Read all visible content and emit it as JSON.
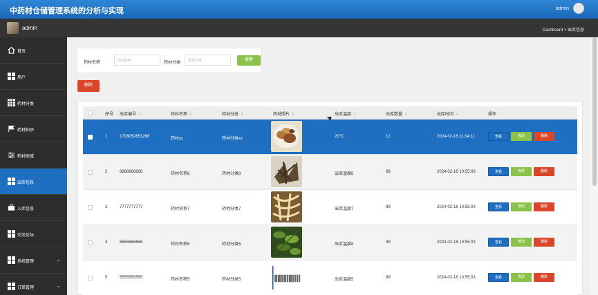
{
  "header": {
    "title": "中药材仓储管理系统的分析与实现",
    "user": "admin"
  },
  "subheader": {
    "username": "admin",
    "breadcrumb": "Dashboard > 出库信息"
  },
  "sidebar": {
    "items": [
      {
        "label": "首页"
      },
      {
        "label": "用户"
      },
      {
        "label": "药材分类"
      },
      {
        "label": "药材知识"
      },
      {
        "label": "药材商城"
      },
      {
        "label": "出库信息"
      },
      {
        "label": "入库信息"
      },
      {
        "label": "交流论坛"
      },
      {
        "label": "系统管理"
      },
      {
        "label": "订单管理"
      }
    ]
  },
  "search": {
    "name_label": "药材名称",
    "name_placeholder": "药材名称",
    "category_label": "药材分类",
    "category_placeholder": "药材分类",
    "search_button": "搜索"
  },
  "toolbar": {
    "delete_label": "删除"
  },
  "table": {
    "columns": [
      "序号",
      "出库编号",
      "药材名称",
      "药材分类",
      "药材照片",
      "出库温度",
      "出库数量",
      "出库时间",
      "操作"
    ],
    "rows": [
      {
        "index": "1",
        "code": "1708052651266",
        "name": "药材xx",
        "category": "药材分类xx",
        "temp": "20°C",
        "qty": "12",
        "time": "2024-02-16 11:04:11"
      },
      {
        "index": "2",
        "code": "8888888888",
        "name": "药材名称8",
        "category": "药材分类8",
        "temp": "出库温度8",
        "qty": "99",
        "time": "2024-02-16 10:55:03"
      },
      {
        "index": "3",
        "code": "7777777777",
        "name": "药材名称7",
        "category": "药材分类7",
        "temp": "出库温度7",
        "qty": "99",
        "time": "2024-02-16 10:55:03"
      },
      {
        "index": "4",
        "code": "6666666666",
        "name": "药材名称6",
        "category": "药材分类6",
        "temp": "出库温度6",
        "qty": "99",
        "time": "2024-02-16 10:55:03"
      },
      {
        "index": "5",
        "code": "5555555555",
        "name": "药材名称5",
        "category": "药材分类5",
        "temp": "出库温度5",
        "qty": "99",
        "time": "2024-02-16 10:55:03"
      }
    ],
    "actions": {
      "view": "查看",
      "edit": "修改",
      "delete": "删除"
    }
  }
}
